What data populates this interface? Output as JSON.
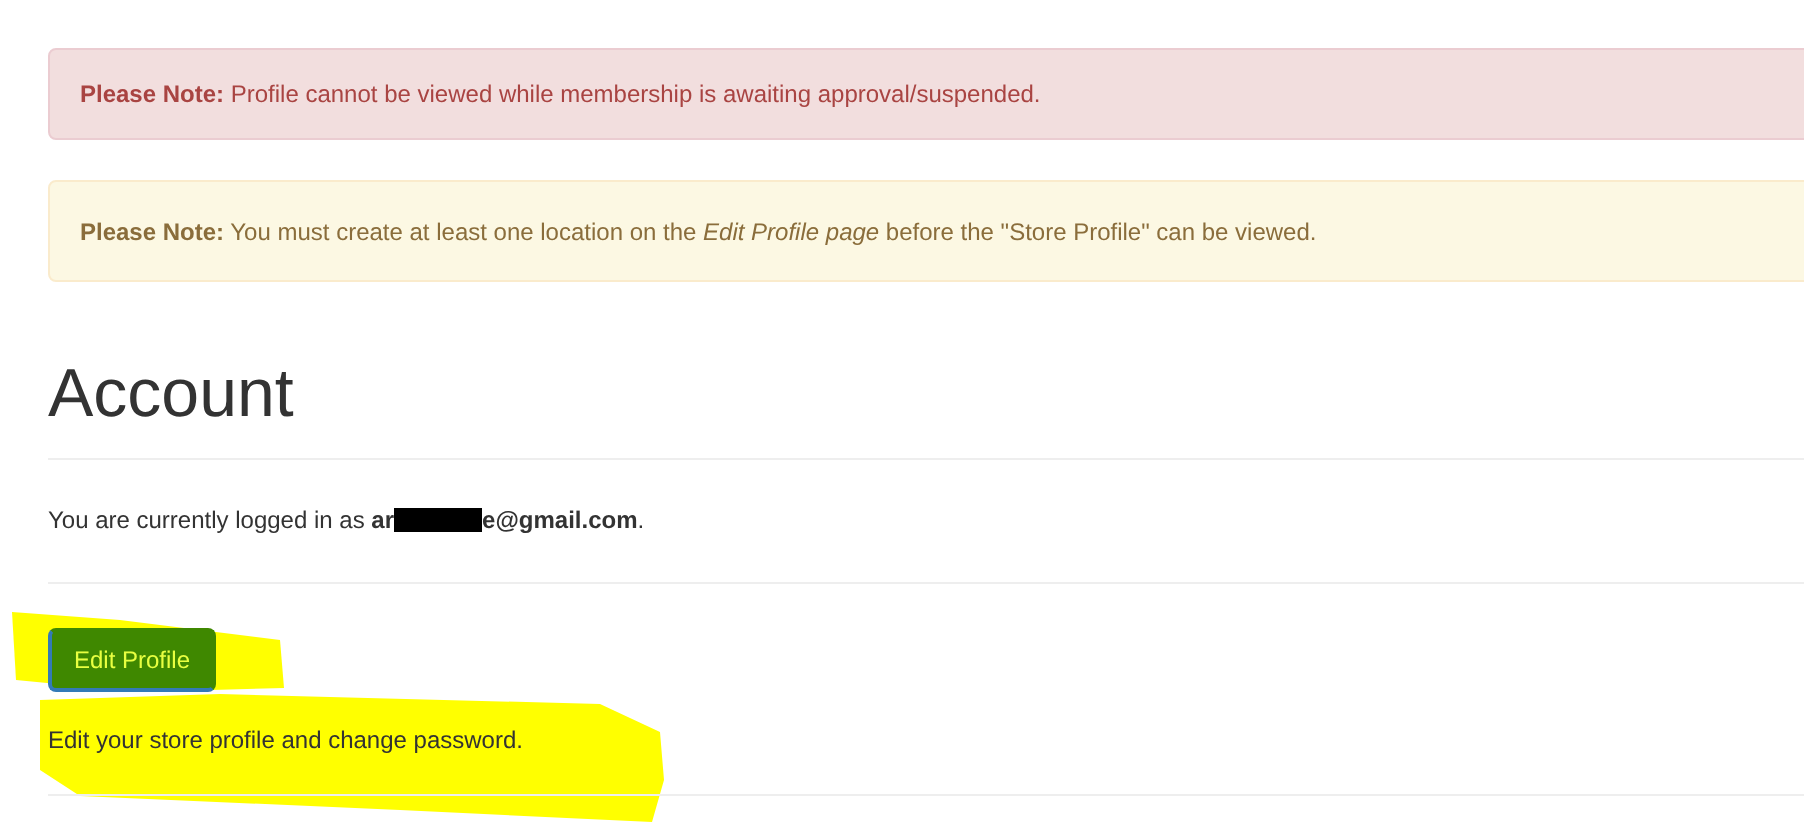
{
  "alerts": [
    {
      "kind": "danger",
      "text": "**Please Note:** Profile cannot be viewed while membership is awaiting approval/suspended."
    },
    {
      "kind": "warning",
      "text": "**Please Note:** You must create at least one location on the *Edit Profile page* before the \"Store Profile\" can be viewed."
    }
  ],
  "heading": "Account",
  "login": {
    "prefix": "You are currently logged in as",
    "email_start": "ar",
    "email_end": "e@gmail.com",
    "suffix": "."
  },
  "edit_button": "Edit Profile",
  "edit_description": "Edit your store profile and change password."
}
